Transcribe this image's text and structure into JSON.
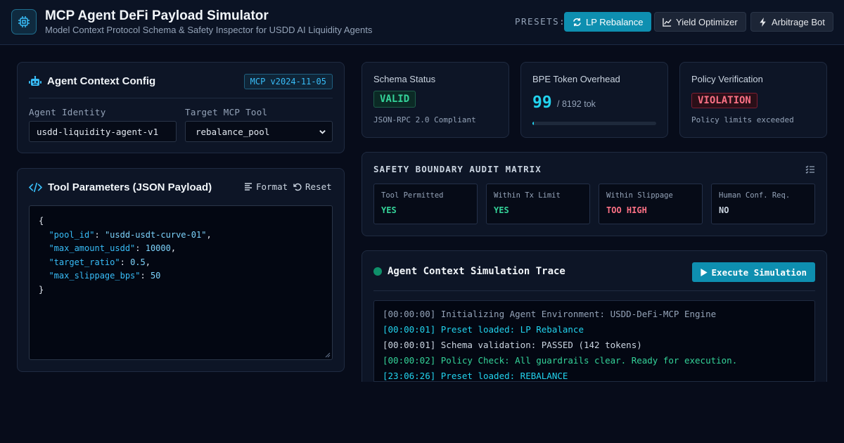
{
  "header": {
    "title": "MCP Agent DeFi Payload Simulator",
    "subtitle": "Model Context Protocol Schema & Safety Inspector for USDD AI Liquidity Agents",
    "presets_label": "PRESETS:",
    "presets": [
      {
        "label": "LP Rebalance",
        "icon": "refresh-icon",
        "active": true
      },
      {
        "label": "Yield Optimizer",
        "icon": "line-chart-icon",
        "active": false
      },
      {
        "label": "Arbitrage Bot",
        "icon": "lightning-icon",
        "active": false
      }
    ]
  },
  "agent_config": {
    "title": "Agent Context Config",
    "version_badge": "MCP v2024-11-05",
    "identity_label": "Agent Identity",
    "identity_value": "usdd-liquidity-agent-v1",
    "tool_label": "Target MCP Tool",
    "tool_value": "rebalance_pool"
  },
  "tool_params": {
    "title": "Tool Parameters (JSON Payload)",
    "format_label": "Format",
    "reset_label": "Reset",
    "payload": [
      {
        "key": "\"pool_id\"",
        "value": "\"usdd-usdt-curve-01\""
      },
      {
        "key": "\"max_amount_usdd\"",
        "value": "10000"
      },
      {
        "key": "\"target_ratio\"",
        "value": "0.5"
      },
      {
        "key": "\"max_slippage_bps\"",
        "value": "50"
      }
    ]
  },
  "schema_status": {
    "label": "Schema Status",
    "value": "VALID",
    "note": "JSON-RPC 2.0 Compliant"
  },
  "token_overhead": {
    "label": "BPE Token Overhead",
    "value": "99",
    "limit_text": "/ 8192 tok",
    "fill_fraction": 0.012
  },
  "policy": {
    "label": "Policy Verification",
    "value": "VIOLATION",
    "note": "Policy limits exceeded"
  },
  "audit_matrix": {
    "title": "SAFETY BOUNDARY AUDIT MATRIX",
    "cells": [
      {
        "label": "Tool Permitted",
        "value": "YES",
        "color": "#34d399"
      },
      {
        "label": "Within Tx Limit",
        "value": "YES",
        "color": "#34d399"
      },
      {
        "label": "Within Slippage",
        "value": "TOO HIGH",
        "color": "#fb7185"
      },
      {
        "label": "Human Conf. Req.",
        "value": "NO",
        "color": "#cbd5e1"
      }
    ]
  },
  "trace": {
    "title": "Agent Context Simulation Trace",
    "execute_label": "Execute Simulation",
    "lines": [
      {
        "text": "[00:00:00] Initializing Agent Environment: USDD-DeFi-MCP Engine",
        "color": "#94a3b8"
      },
      {
        "text": "[00:00:01] Preset loaded: LP Rebalance",
        "color": "#22d3ee"
      },
      {
        "text": "[00:00:01] Schema validation: PASSED (142 tokens)",
        "color": "#cbd5e1"
      },
      {
        "text": "[00:00:02] Policy Check: All guardrails clear. Ready for execution.",
        "color": "#34d399"
      },
      {
        "text": "[23:06:26] Preset loaded: REBALANCE",
        "color": "#22d3ee"
      }
    ]
  },
  "colors": {
    "accent": "#0e8fb0",
    "cyan": "#22d3ee",
    "success": "#34d399",
    "danger": "#fb7185"
  }
}
